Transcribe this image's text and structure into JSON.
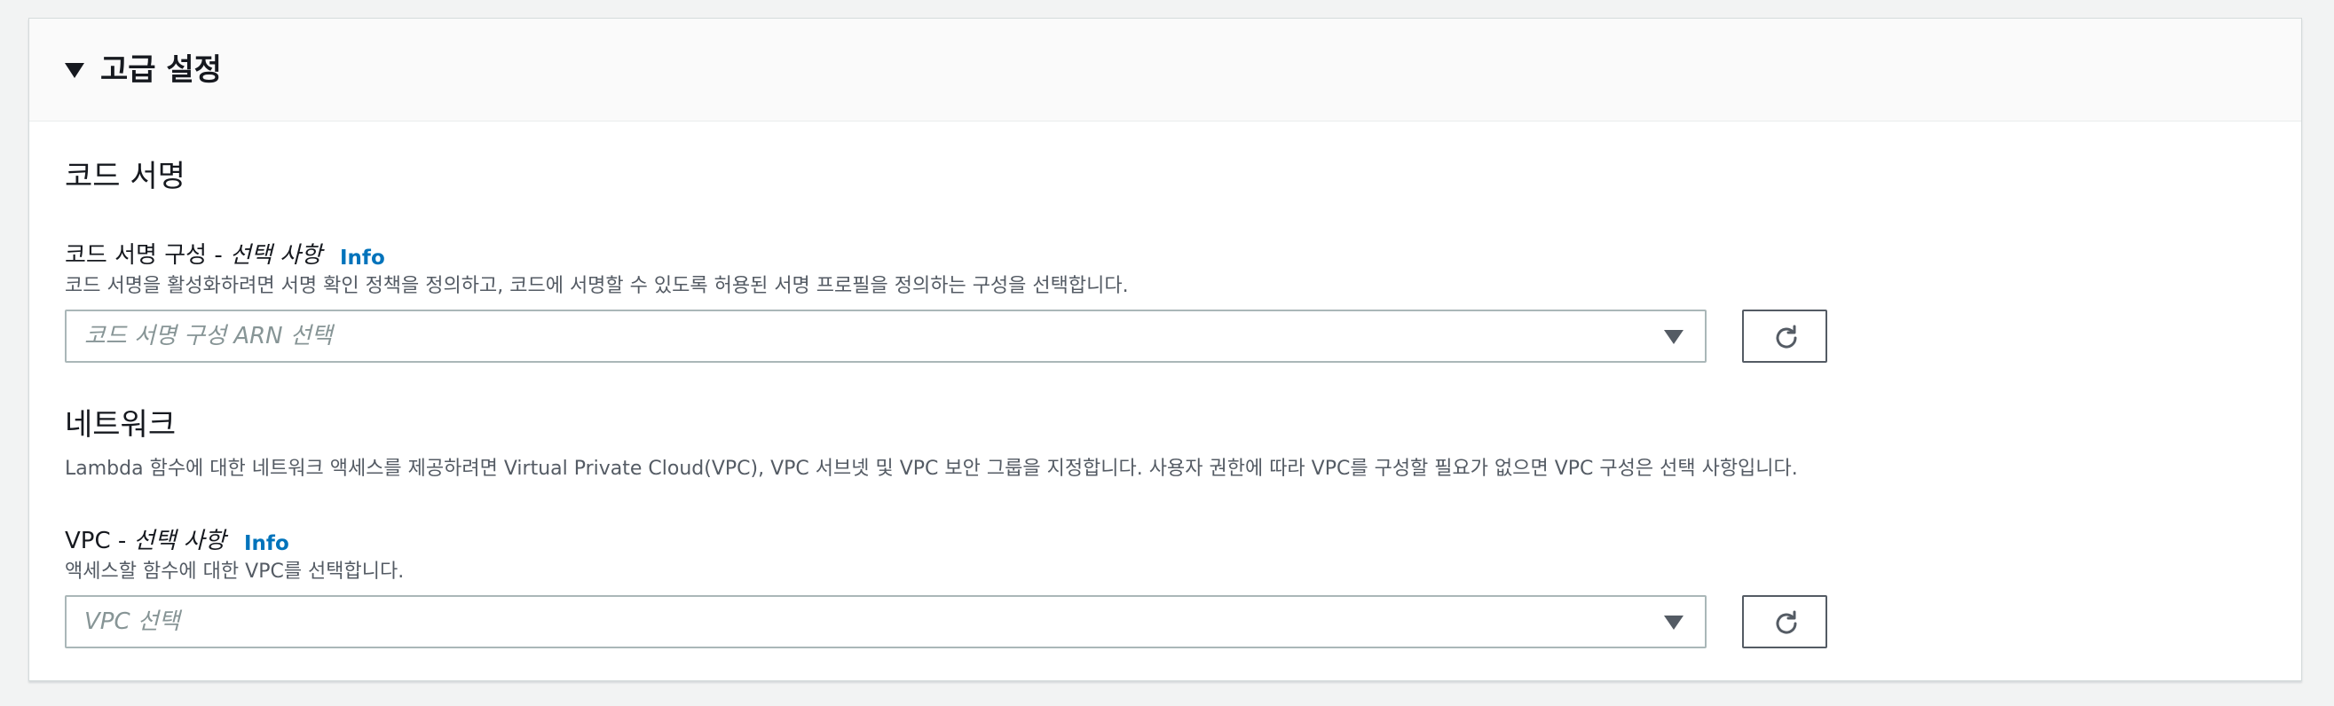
{
  "header": {
    "title": "고급 설정",
    "expand_icon": "caret-down-icon"
  },
  "code_signing": {
    "section_title": "코드 서명",
    "label_main": "코드 서명 구성 - ",
    "label_optional": "선택 사항",
    "info_label": "Info",
    "description": "코드 서명을 활성화하려면 서명 확인 정책을 정의하고, 코드에 서명할 수 있도록 허용된 서명 프로필을 정의하는 구성을 선택합니다.",
    "select_placeholder": "코드 서명 구성 ARN 선택",
    "refresh_icon": "refresh-icon"
  },
  "network": {
    "section_title": "네트워크",
    "description": "Lambda 함수에 대한 네트워크 액세스를 제공하려면 Virtual Private Cloud(VPC), VPC 서브넷 및 VPC 보안 그룹을 지정합니다. 사용자 권한에 따라 VPC를 구성할 필요가 없으면 VPC 구성은 선택 사항입니다.",
    "vpc_label_main": "VPC - ",
    "vpc_label_optional": "선택 사항",
    "info_label": "Info",
    "vpc_description": "액세스할 함수에 대한 VPC를 선택합니다.",
    "vpc_placeholder": "VPC 선택",
    "refresh_icon": "refresh-icon"
  },
  "colors": {
    "link": "#0073bb",
    "text": "#16191f",
    "muted": "#545b64",
    "placeholder": "#879596",
    "border": "#aab7b8"
  }
}
